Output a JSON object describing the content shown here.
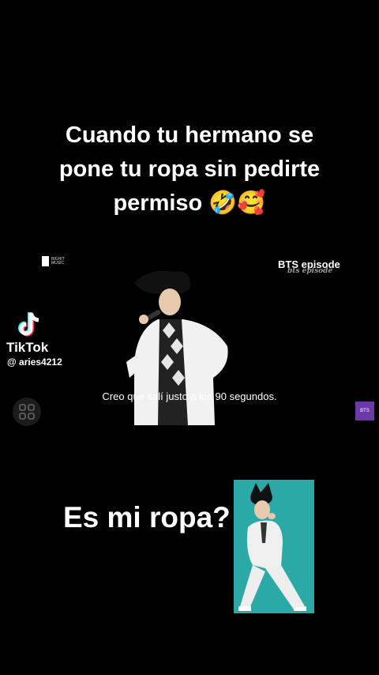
{
  "caption": {
    "line1": "Cuando tu hermano se",
    "line2": "pone tu ropa sin pedirte",
    "line3": "permiso 🤣🥰"
  },
  "brand_left": {
    "line1": "BIGHIT",
    "line2": "MUSIC"
  },
  "brand_right": {
    "title": "BTS episode",
    "script": "bts episode"
  },
  "tiktok": {
    "word": "TikTok",
    "username": "@ aries4212"
  },
  "subtitle": "Creo que salí justo a los 90 segundos.",
  "badge": "BTS",
  "question": "Es mi ropa?",
  "colors": {
    "background": "#000000",
    "photo_bg": "#2aa9a6",
    "badge": "#6b3aa8"
  }
}
